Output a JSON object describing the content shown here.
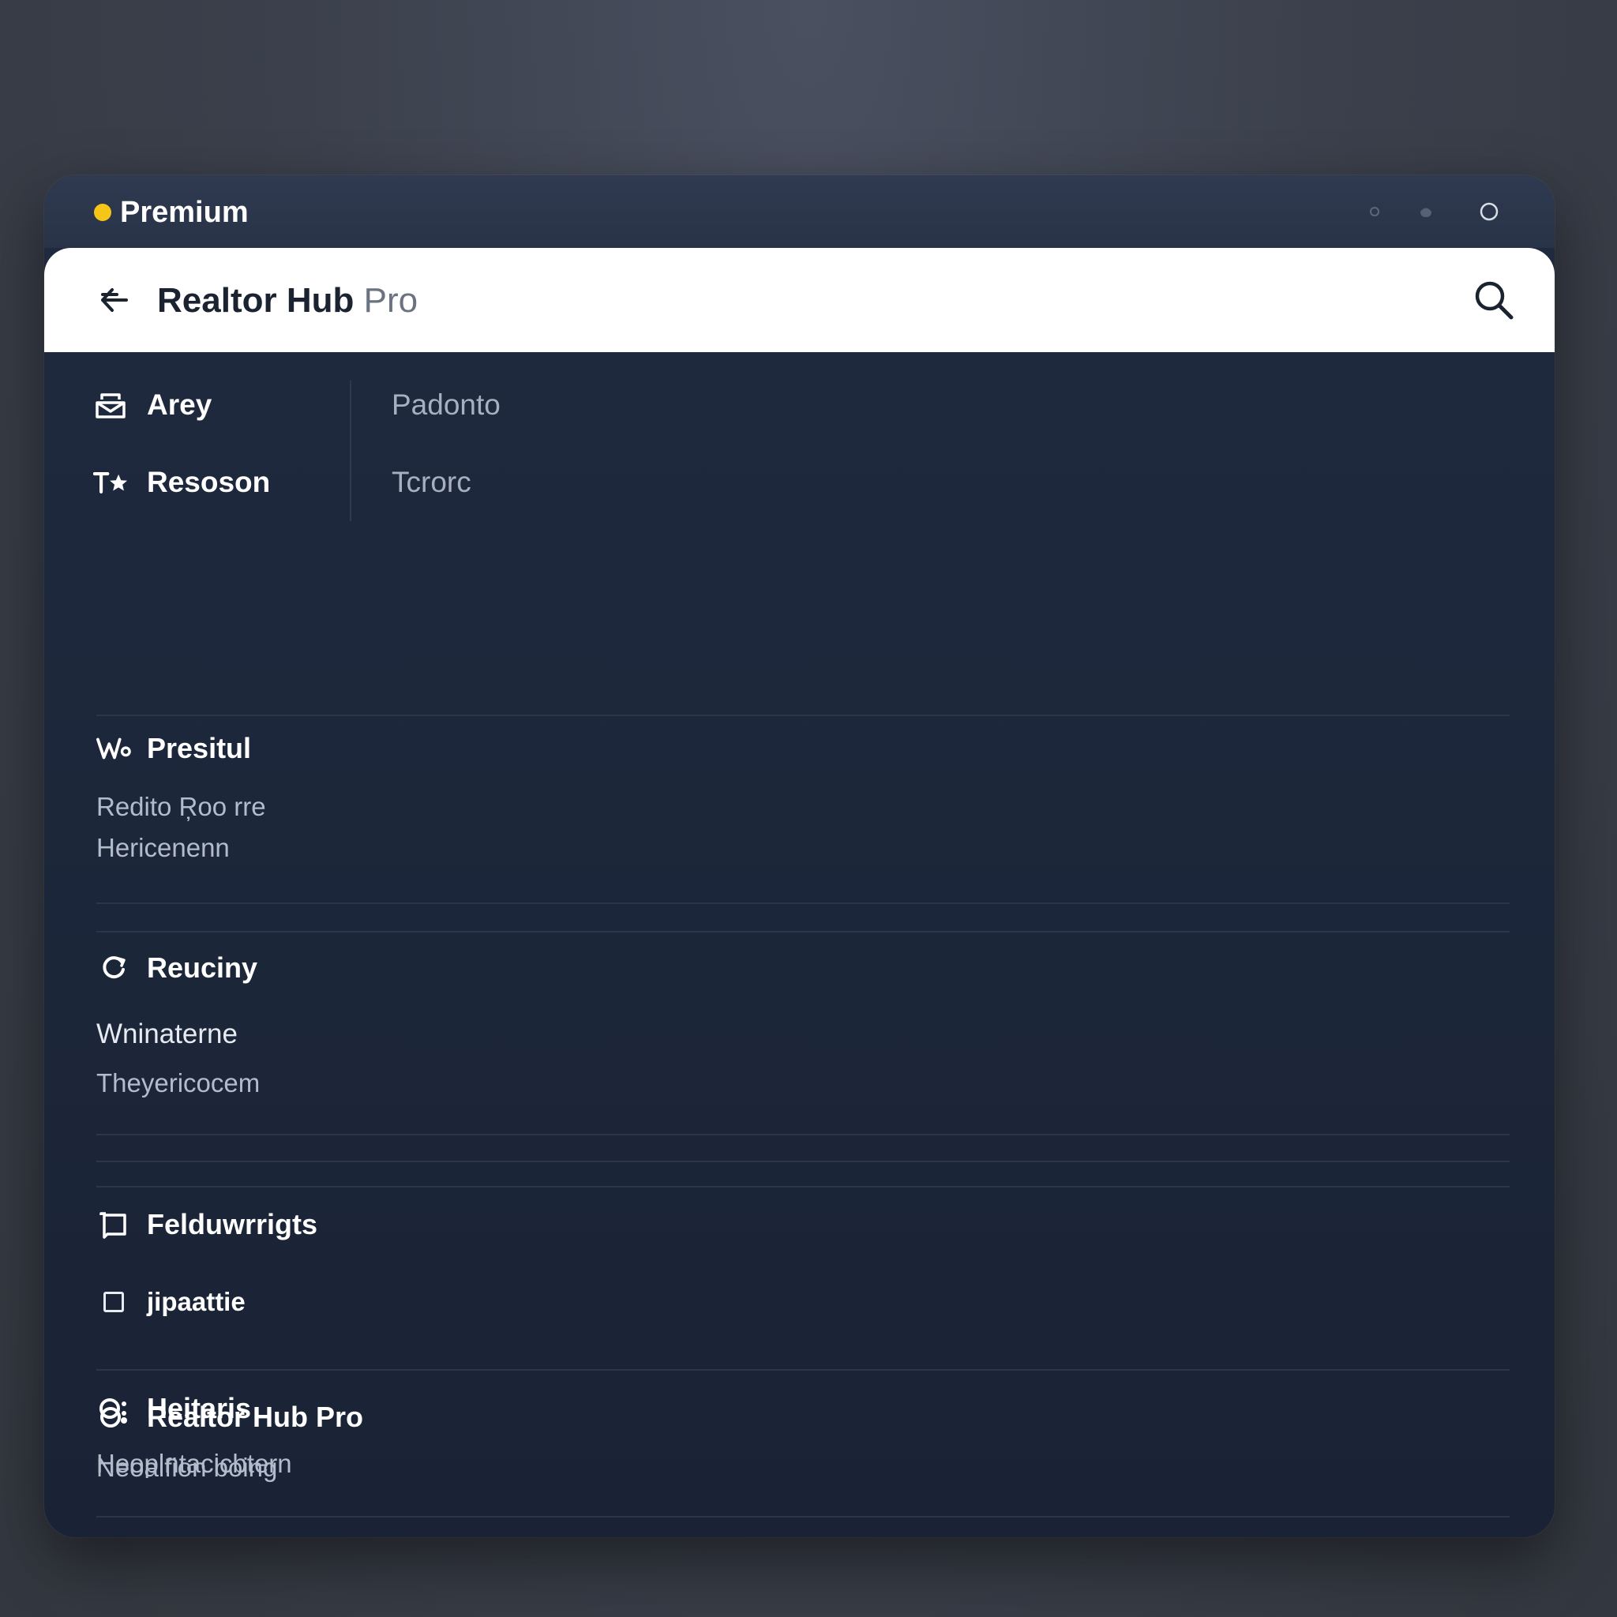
{
  "topbar": {
    "badge_label": "Premium",
    "badge_color": "#f5c518",
    "controls": [
      "dot-icon",
      "drop-icon",
      "circle-icon"
    ]
  },
  "header": {
    "title_strong": "Realtor Hub",
    "title_light": "Pro",
    "back_icon": "arrow-left-icon",
    "search_icon": "search-icon"
  },
  "nav": {
    "left": [
      {
        "label": "Arey",
        "icon": "mailbox-icon"
      },
      {
        "label": "Resoson",
        "icon": "text-star-icon"
      }
    ],
    "right": [
      {
        "value": "Padonto"
      },
      {
        "value": "Tcrorc"
      }
    ]
  },
  "sections": [
    {
      "title": "Presitul",
      "icon": "wave-icon",
      "lines": [
        "Redito Ŗoo rre",
        "Hericenenn"
      ]
    },
    {
      "title": "Reuciny",
      "icon": "circle-arrow-icon",
      "lines": [
        "Wninaterne",
        "Theyericocem"
      ]
    },
    {
      "title": "Felduwrrigts",
      "icon": "frame-icon",
      "checkbox_label": "jipaattie"
    },
    {
      "title": "Realtor Hub Pro",
      "icon": "circle-dot-icon",
      "lines": [
        "Neoaifion boing"
      ]
    },
    {
      "title": "Heitaris",
      "icon": "circle-colon-icon",
      "lines": [
        "Heoplntacicbtern"
      ]
    }
  ]
}
